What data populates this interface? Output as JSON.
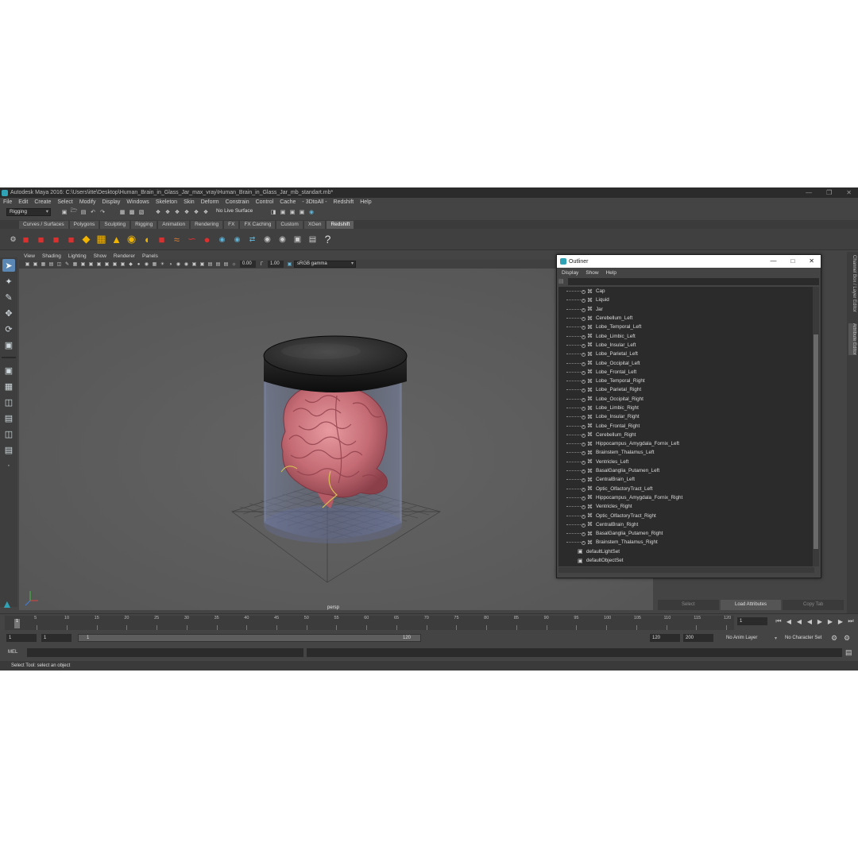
{
  "window": {
    "title": "Autodesk Maya 2016: C:\\Users\\itte\\Desktop\\Human_Brain_in_Glass_Jar_max_vray\\Human_Brain_in_Glass_Jar_mb_standart.mb*",
    "minimize": "—",
    "restore": "❐",
    "close": "✕"
  },
  "menubar": [
    "File",
    "Edit",
    "Create",
    "Select",
    "Modify",
    "Display",
    "Windows",
    "Skeleton",
    "Skin",
    "Deform",
    "Constrain",
    "Control",
    "Cache",
    "- 3DtoAll -",
    "Redshift",
    "Help"
  ],
  "statusline": {
    "mode": "Rigging",
    "live_surface": "No Live Surface"
  },
  "shelf_tabs": [
    "Curves / Surfaces",
    "Polygons",
    "Sculpting",
    "Rigging",
    "Animation",
    "Rendering",
    "FX",
    "FX Caching",
    "Custom",
    "XGen",
    "Redshift"
  ],
  "active_shelf": "Redshift",
  "viewport": {
    "menu": [
      "View",
      "Shading",
      "Lighting",
      "Show",
      "Renderer",
      "Panels"
    ],
    "exposure": "0.00",
    "gamma": "1.00",
    "color_space": "sRGB gamma",
    "camera_label": "persp"
  },
  "outliner": {
    "title": "Outliner",
    "menu": [
      "Display",
      "Show",
      "Help"
    ],
    "items": [
      "Cap",
      "Liquid",
      "Jar",
      "Cerebellum_Left",
      "Lobe_Temporal_Left",
      "Lobe_Limbic_Left",
      "Lobe_Insular_Left",
      "Lobe_Parietal_Left",
      "Lobe_Occipital_Left",
      "Lobe_Frontal_Left",
      "Lobe_Temporal_Right",
      "Lobe_Parietal_Right",
      "Lobe_Occipital_Right",
      "Lobe_Limbic_Right",
      "Lobe_Insular_Right",
      "Lobe_Frontal_Right",
      "Cerebellum_Right",
      "Hippocampus_Amygdala_Fornix_Left",
      "Brainstem_Thalamus_Left",
      "Ventricles_Left",
      "BasalGanglia_Putamen_Left",
      "CentralBrain_Left",
      "Optic_OlfactoryTract_Left",
      "Hippocampus_Amygdala_Fornix_Right",
      "Ventricles_Right",
      "Optic_OlfactoryTract_Right",
      "CentralBrain_Right",
      "BasalGanglia_Putamen_Right",
      "Brainstem_Thalamus_Right"
    ],
    "sets": [
      "defaultLightSet",
      "defaultObjectSet"
    ]
  },
  "attribute_buttons": [
    "Select",
    "Load Attributes",
    "Copy Tab"
  ],
  "side_tabs": [
    "Channel Box / Layer Editor",
    "Attribute Editor"
  ],
  "timeline": {
    "ticks": [
      "5",
      "10",
      "15",
      "20",
      "25",
      "30",
      "35",
      "40",
      "45",
      "50",
      "55",
      "60",
      "65",
      "70",
      "75",
      "80",
      "85",
      "90",
      "95",
      "100",
      "105",
      "110",
      "115",
      "120"
    ],
    "current_frame_marker": "1",
    "current_frame": "1"
  },
  "range": {
    "start": "1",
    "anim_start": "1",
    "slider_start": "1",
    "slider_end": "120",
    "end": "120",
    "anim_end": "200",
    "anim_layer": "No Anim Layer",
    "character_set": "No Character Set"
  },
  "mel": {
    "label": "MEL"
  },
  "help_line": "Select Tool: select an object",
  "colors": {
    "ui_bg": "#444444",
    "viewport_bg": "#5a5a5a",
    "accent": "#5a87b3",
    "brain": "#c9727a",
    "cap": "#1a1a1a"
  }
}
